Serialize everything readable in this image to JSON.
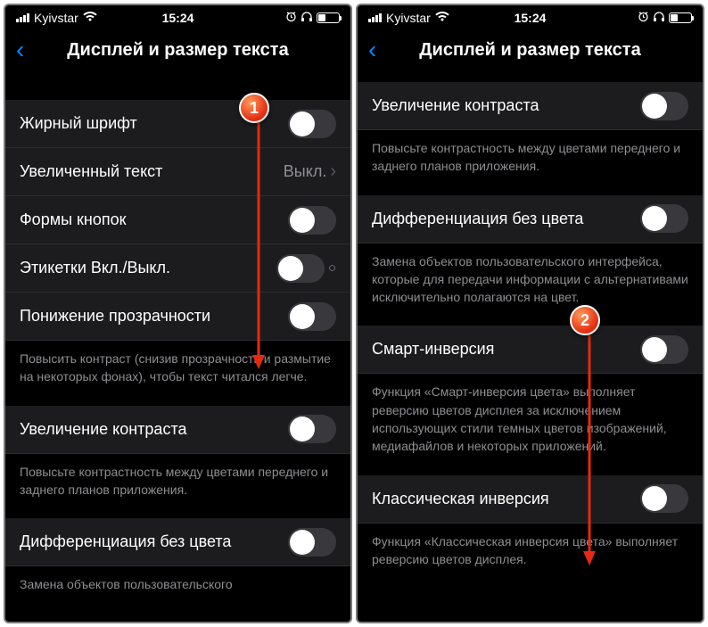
{
  "statusBar": {
    "carrier": "Kyivstar",
    "time": "15:24"
  },
  "header": {
    "title": "Дисплей и размер текста"
  },
  "left": {
    "rows": {
      "boldText": "Жирный шрифт",
      "largerText": "Увеличенный текст",
      "largerTextValue": "Выкл.",
      "buttonShapes": "Формы кнопок",
      "onOffLabels": "Этикетки Вкл./Выкл.",
      "reduceTransparency": "Понижение прозрачности",
      "increaseContrast": "Увеличение контраста",
      "diffColor": "Дифференциация без цвета"
    },
    "footers": {
      "transparency": "Повысить контраст (снизив прозрачность и размытие на некоторых фонах), чтобы текст читался легче.",
      "contrast": "Повысьте контрастность между цветами переднего и заднего планов приложения.",
      "diffColor": "Замена объектов пользовательского"
    }
  },
  "right": {
    "rows": {
      "increaseContrast": "Увеличение контраста",
      "diffColor": "Дифференциация без цвета",
      "smartInvert": "Смарт-инверсия",
      "classicInvert": "Классическая инверсия"
    },
    "footers": {
      "contrast": "Повысьте контрастность между цветами переднего и заднего планов приложения.",
      "diffColor": "Замена объектов пользовательского интерфейса, которые для передачи информации с альтернативами исключительно полагаются на цвет.",
      "smartInvert": "Функция «Смарт-инверсия цвета» выполняет реверсию цветов дисплея за исключением использующих стили темных цветов изображений, медиафайлов и некоторых приложений.",
      "classicInvert": "Функция «Классическая инверсия цвета» выполняет реверсию цветов дисплея."
    }
  },
  "markers": {
    "one": "1",
    "two": "2"
  }
}
